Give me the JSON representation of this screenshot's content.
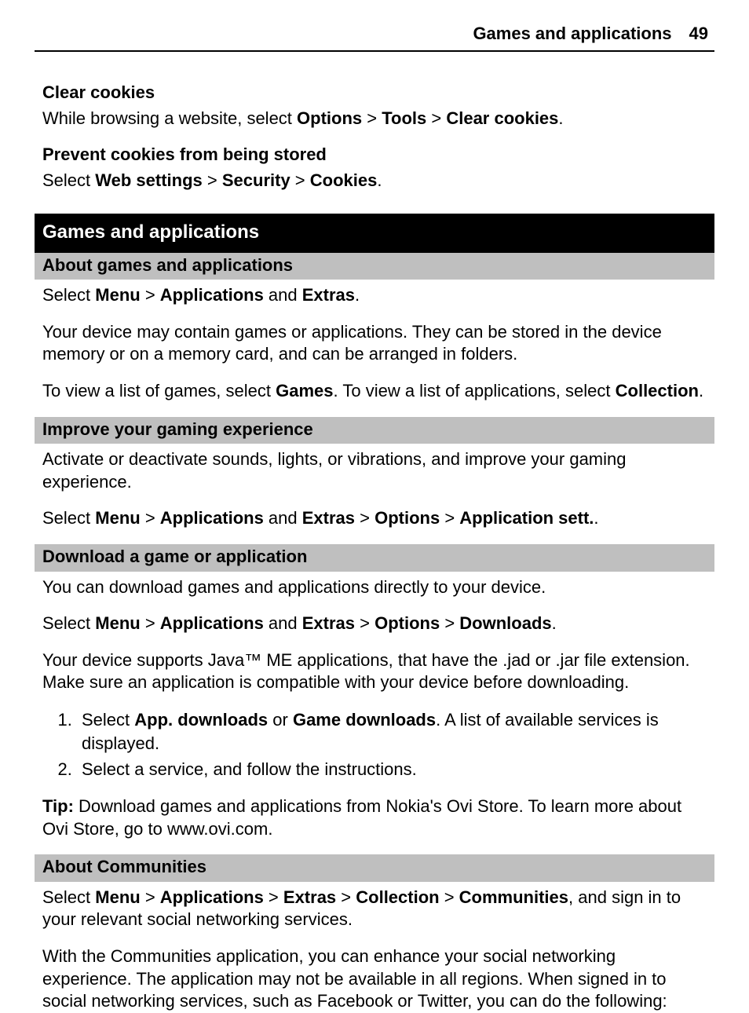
{
  "header": {
    "title": "Games and applications",
    "page": "49"
  },
  "sec1": {
    "h1": "Clear cookies",
    "p1a": "While browsing a website, select ",
    "p1b": "Options",
    "p1c": "  > ",
    "p1d": "Tools",
    "p1e": "  > ",
    "p1f": "Clear cookies",
    "p1g": "."
  },
  "sec2": {
    "h1": "Prevent cookies from being stored",
    "p1a": "Select ",
    "p1b": "Web settings",
    "p1c": "  > ",
    "p1d": "Security",
    "p1e": "  > ",
    "p1f": "Cookies",
    "p1g": "."
  },
  "band1": "Games and applications",
  "gray1": "About games and applications",
  "sec3": {
    "p1a": "Select ",
    "p1b": "Menu",
    "p1c": "  > ",
    "p1d": "Applications",
    "p1e": " and ",
    "p1f": "Extras",
    "p1g": ".",
    "p2": "Your device may contain games or applications. They can be stored in the device memory or on a memory card, and can be arranged in folders.",
    "p3a": "To view a list of games, select ",
    "p3b": "Games",
    "p3c": ". To view a list of applications, select ",
    "p3d": "Collection",
    "p3e": "."
  },
  "gray2": "Improve your gaming experience",
  "sec4": {
    "p1": "Activate or deactivate sounds, lights, or vibrations, and improve your gaming experience.",
    "p2a": "Select ",
    "p2b": "Menu",
    "p2c": "  > ",
    "p2d": "Applications",
    "p2e": " and ",
    "p2f": "Extras",
    "p2g": "  > ",
    "p2h": "Options",
    "p2i": "  > ",
    "p2j": "Application sett.",
    "p2k": "."
  },
  "gray3": "Download a game or application",
  "sec5": {
    "p1": "You can download games and applications directly to your device.",
    "p2a": "Select ",
    "p2b": "Menu",
    "p2c": "  > ",
    "p2d": "Applications",
    "p2e": " and ",
    "p2f": "Extras",
    "p2g": "  > ",
    "p2h": "Options",
    "p2i": "  > ",
    "p2j": "Downloads",
    "p2k": ".",
    "p3": "Your device supports Java™ ME applications, that have the .jad or .jar file extension. Make sure an application is compatible with your device before downloading.",
    "li1a": "Select ",
    "li1b": "App. downloads",
    "li1c": " or ",
    "li1d": "Game downloads",
    "li1e": ". A list of available services is displayed.",
    "li2": "Select a service, and follow the instructions.",
    "tip_a": "Tip: ",
    "tip_b": "Download games and applications from Nokia's Ovi Store. To learn more about Ovi Store, go to www.ovi.com."
  },
  "gray4": "About Communities",
  "sec6": {
    "p1a": "Select ",
    "p1b": "Menu",
    "p1c": "  > ",
    "p1d": "Applications",
    "p1e": "  > ",
    "p1f": "Extras",
    "p1g": "  > ",
    "p1h": "Collection",
    "p1i": "  > ",
    "p1j": "Communities",
    "p1k": ", and sign in to your relevant social networking services.",
    "p2": "With the Communities application, you can enhance your social networking experience. The application may not be available in all regions. When signed in to social networking services, such as Facebook or Twitter, you can do the following:"
  }
}
